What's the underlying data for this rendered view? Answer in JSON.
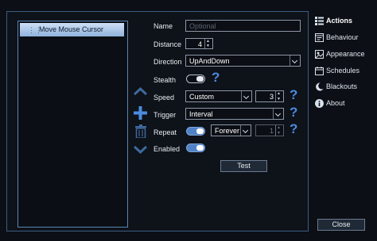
{
  "list": {
    "items": [
      {
        "label": "Move Mouse Cursor"
      }
    ]
  },
  "form": {
    "name": {
      "label": "Name",
      "placeholder": "Optional"
    },
    "distance": {
      "label": "Distance",
      "value": "4"
    },
    "direction": {
      "label": "Direction",
      "value": "UpAndDown"
    },
    "stealth": {
      "label": "Stealth",
      "state": "off"
    },
    "speed": {
      "label": "Speed",
      "mode": "Custom",
      "value": "3"
    },
    "trigger": {
      "label": "Trigger",
      "value": "Interval"
    },
    "repeat": {
      "label": "Repeat",
      "state": "on",
      "mode": "Forever",
      "count": "1"
    },
    "enabled": {
      "label": "Enabled",
      "state": "on"
    },
    "help_glyph": "?"
  },
  "buttons": {
    "test": "Test",
    "close": "Close"
  },
  "nav": [
    {
      "label": "Actions",
      "icon": "actions-icon",
      "active": true
    },
    {
      "label": "Behaviour",
      "icon": "behaviour-icon"
    },
    {
      "label": "Appearance",
      "icon": "appearance-icon"
    },
    {
      "label": "Schedules",
      "icon": "schedules-icon"
    },
    {
      "label": "Blackouts",
      "icon": "blackouts-icon"
    },
    {
      "label": "About",
      "icon": "about-icon"
    }
  ],
  "colors": {
    "accent": "#4a8be0",
    "selection": "#a9c6ea",
    "border": "#3d5c80"
  }
}
